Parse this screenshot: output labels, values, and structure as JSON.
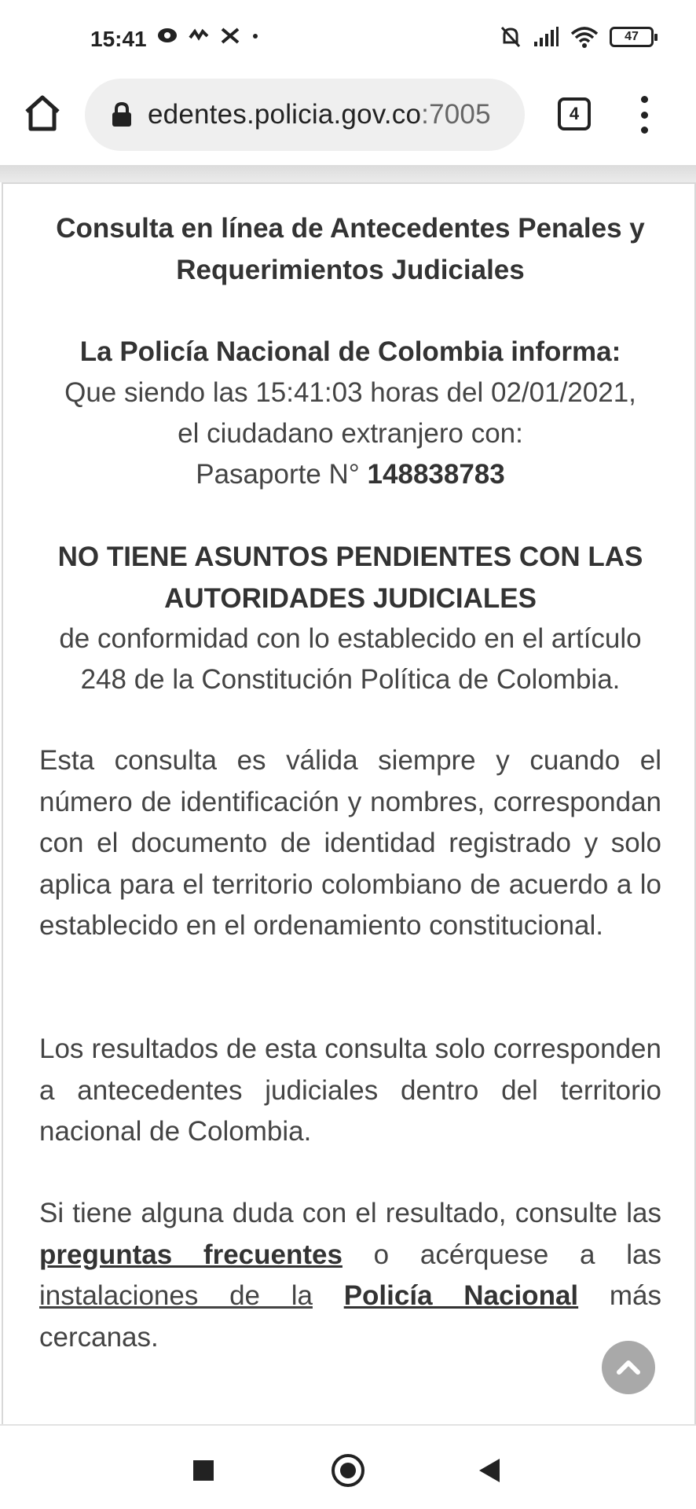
{
  "status_bar": {
    "time": "15:41",
    "battery": "47",
    "left_icons": [
      "message-icon",
      "wave-icon",
      "crossed-arrows-icon",
      "dot-icon"
    ],
    "right_icons": [
      "bell-muted-icon",
      "signal-icon",
      "wifi-icon",
      "battery-icon"
    ]
  },
  "browser": {
    "url_main": "edentes.policia.gov.co",
    "url_port": ":7005",
    "tab_count": "4"
  },
  "page": {
    "title_line1": "Consulta en línea de Antecedentes Penales y",
    "title_line2": "Requerimientos Judiciales",
    "info_heading": "La Policía Nacional de Colombia informa:",
    "info_line1": "Que siendo las 15:41:03 horas del 02/01/2021,",
    "info_line2": "el ciudadano extranjero con:",
    "passport_label": "Pasaporte N°",
    "passport_number": "148838783",
    "notice_line1": "NO TIENE ASUNTOS PENDIENTES CON LAS",
    "notice_line2": "AUTORIDADES JUDICIALES",
    "conformity_line1": "de conformidad con lo establecido en el artículo",
    "conformity_line2": "248 de la Constitución Política de Colombia.",
    "para_validity": "Esta consulta es válida siempre y cuando el número de identificación y nombres, correspondan con el documento de identidad registrado y solo aplica para el territorio colombiano de acuerdo a lo establecido en el ordenamiento constitucional.",
    "para_results": "Los resultados de esta consulta solo corresponden a antecedentes judiciales dentro del territorio nacional de Colombia.",
    "faq_prefix": "Si tiene alguna duda con el resultado, consulte las",
    "faq_link": "preguntas frecuentes",
    "faq_middle": "o acérquese a las",
    "facilities_text": "instalaciones de la",
    "police_link": "Policía Nacional",
    "faq_suffix": "más cercanas."
  }
}
